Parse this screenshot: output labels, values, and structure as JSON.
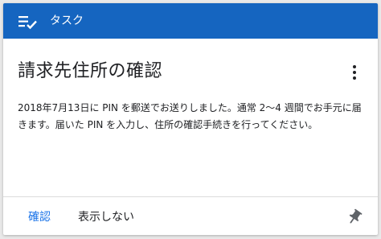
{
  "header": {
    "title": "タスク",
    "color": "#1565c0",
    "icon": "task-list-icon"
  },
  "card": {
    "title": "請求先住所の確認",
    "body": "2018年7月13日に PIN を郵送でお送りしました。通常 2〜4 週間でお手元に届きます。届いた PIN を入力し、住所の確認手続きを行ってください。",
    "menu_icon": "more-vert-icon"
  },
  "actions": {
    "confirm_label": "確認",
    "dismiss_label": "表示しない",
    "pin_icon": "pin-icon",
    "accent_color": "#1a73e8"
  }
}
